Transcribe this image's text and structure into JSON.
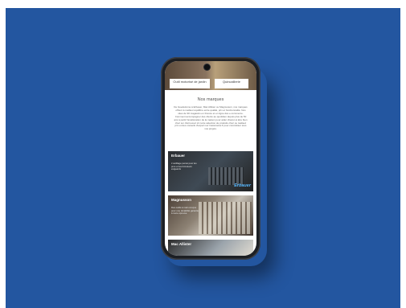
{
  "screen": {
    "top_cards": [
      {
        "label": "Outil motorisé de jardin"
      },
      {
        "label": "Quincaillerie"
      }
    ],
    "section_title": "Nos marques",
    "intro_text": "De Guedelonne à Erbauer, Mac Allister ou Magnusson, nos marques offrent à meilleur équilibre entre qualité, prix et fonctionnalité. Nos sites de 90 magasins en France et en ligne dès e-commerce. Comment accompagner des clients au quotidien depuis plus de 50 ans à partir l'amélioration de la maison pour aider chacun à être bien chez soi. Retrouvez ici notre sélection de produits chez ou réalisez prix et des conseils d'expert sur Castorama.fr pour concrétiser tous vos projets.",
    "brands": [
      {
        "name": "Erbauer",
        "description": "L'outillage pensé pour les pros et les bricoleurs exigeants",
        "logo": "Erbauer"
      },
      {
        "name": "Magnusson",
        "description": "Des outils à main conçus pour une durabilité garantie à toute épreuve",
        "logo": ""
      },
      {
        "name": "Mac Allister",
        "description": "",
        "logo": ""
      }
    ]
  },
  "colors": {
    "background": "#2356a0",
    "phone_frame": "#1c1f24",
    "erbauer_logo": "#58b8ff"
  }
}
